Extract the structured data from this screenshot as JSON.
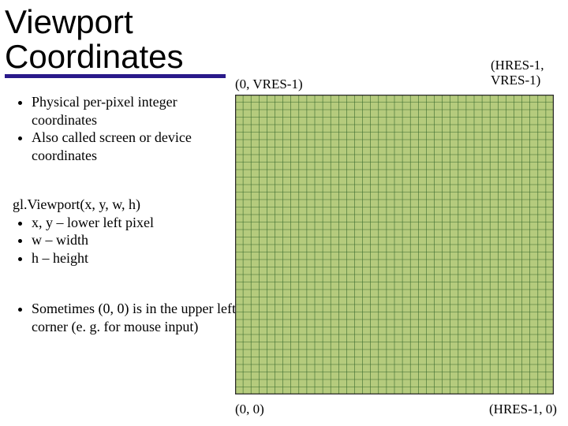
{
  "title": "Viewport\nCoordinates",
  "labels": {
    "top_left": "(0, VRES-1)",
    "top_right_line1": "(HRES-1,",
    "top_right_line2": "VRES-1)",
    "bottom_left": "(0, 0)",
    "bottom_right": "(HRES-1, 0)"
  },
  "bullets1": {
    "b1": "Physical per-pixel integer coordinates",
    "b2": "Also called screen or device coordinates"
  },
  "group2": {
    "heading": "gl.Viewport(x, y, w, h)",
    "b1": "x, y – lower left pixel",
    "b2": "w – width",
    "b3": "h – height"
  },
  "bullets3": {
    "b1": "Sometimes (0, 0) is in the upper left corner (e. g. for mouse input)"
  },
  "grid": {
    "cols": 40,
    "rows": 40,
    "fill": "#b5cb7d",
    "line": "#3b6b2f",
    "border": "#2a2a2a"
  }
}
